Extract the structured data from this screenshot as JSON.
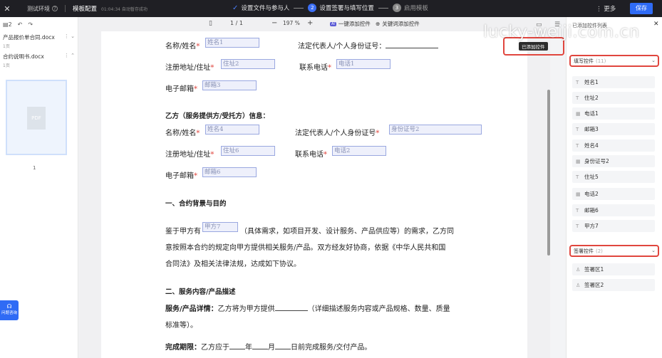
{
  "topbar": {
    "env_label": "测试环境",
    "template_title": "模板配置",
    "saved_text": "01:04:34 自动暂存成功",
    "steps": [
      {
        "label": "设置文件与参与人",
        "state": "done"
      },
      {
        "num": "2",
        "label": "设置签署与填写位置",
        "state": "active"
      },
      {
        "num": "3",
        "label": "启用模板",
        "state": "pending"
      }
    ],
    "more_label": "更多",
    "save_label": "保存"
  },
  "left_panel": {
    "file_count": "2",
    "files": [
      {
        "name": "产品报价单合同.docx",
        "pages": "1页"
      },
      {
        "name": "合约说明书.docx",
        "pages": "1页"
      }
    ],
    "thumb_label": "PDF",
    "thumb_page": "1",
    "help_label": "问题咨询"
  },
  "doc_toolbar": {
    "page_current": "1",
    "page_total": "1",
    "zoom": "197",
    "zoom_unit": "%",
    "one_click_add": "一键添加控件",
    "badge": "AI",
    "keyword_add": "关键词添加控件"
  },
  "document": {
    "partyA": {
      "name_label": "名称/姓名",
      "name_field": "姓名1",
      "legal_label": "法定代表人/个人身份证号：",
      "addr_label": "注册地址/住址",
      "addr_field": "住址2",
      "phone_label": "联系电话",
      "phone_field": "电话1",
      "email_label": "电子邮箱",
      "email_field": "邮箱3"
    },
    "partyB_heading": "乙方（服务提供方/受托方）信息：",
    "partyB": {
      "name_label": "名称/姓名",
      "name_field": "姓名4",
      "legal_label": "法定代表人/个人身份证号",
      "legal_field": "身份证号2",
      "addr_label": "注册地址/住址",
      "addr_field": "住址6",
      "phone_label": "联系电话",
      "phone_field": "电话2",
      "email_label": "电子邮箱",
      "email_field": "邮箱6"
    },
    "section1_heading": "一、合约背景与目的",
    "para1_line1_a": "鉴于甲方有",
    "para1_field": "甲方7",
    "para1_line1_b": "（具体需求，如项目开发、设计服务、产品供应等）的需求，乙方同",
    "para1_line2": "意按照本合约的规定向甲方提供相关服务/产品。双方经友好协商，依据《中华人民共和国",
    "para1_line3": "合同法》及相关法律法规，达成如下协议。",
    "section2_heading": "二、服务内容/产品描述",
    "detail_label": "服务/产品详情：",
    "detail_text_a": "乙方将为甲方提供",
    "detail_text_b": "（详细描述服务内容或产品规格、数量、质量",
    "detail_line2": "标准等）。",
    "deadline_label": "完成期限：",
    "deadline_a": "乙方应于",
    "deadline_year": "年",
    "deadline_month": "月",
    "deadline_b": "日前完成服务/交付产品。"
  },
  "popover": {
    "tip": "已添加控件"
  },
  "right_panel": {
    "title": "已添加控件列表",
    "fill_group": {
      "label": "填写控件",
      "count": "(11)"
    },
    "fill_items": [
      {
        "icon": "T",
        "label": "姓名1"
      },
      {
        "icon": "T",
        "label": "住址2"
      },
      {
        "icon": "▦",
        "label": "电话1"
      },
      {
        "icon": "T",
        "label": "邮箱3"
      },
      {
        "icon": "T",
        "label": "姓名4"
      },
      {
        "icon": "▦",
        "label": "身份证号2"
      },
      {
        "icon": "T",
        "label": "住址5"
      },
      {
        "icon": "▦",
        "label": "电话2"
      },
      {
        "icon": "T",
        "label": "邮箱6"
      },
      {
        "icon": "T",
        "label": "甲方7"
      }
    ],
    "sign_group": {
      "label": "签署控件",
      "count": "(2)"
    },
    "sign_items": [
      {
        "icon": "♙",
        "label": "签署区1"
      },
      {
        "icon": "♙",
        "label": "签署区2"
      }
    ]
  },
  "watermark": "lucky-weiji.com.cn"
}
